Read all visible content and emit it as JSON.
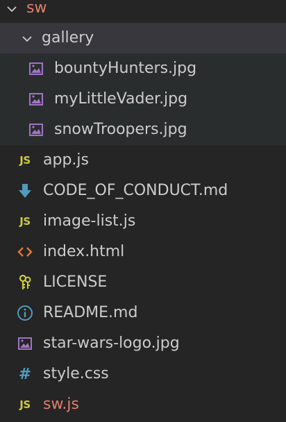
{
  "explorer": {
    "root": {
      "label": "sw",
      "expanded": true,
      "color": "#e37e6b"
    },
    "items": [
      {
        "label": "gallery",
        "type": "folder",
        "expanded": true,
        "icon": "chevron-down-icon"
      },
      {
        "label": "bountyHunters.jpg",
        "type": "image",
        "icon": "image-icon"
      },
      {
        "label": "myLittleVader.jpg",
        "type": "image",
        "icon": "image-icon"
      },
      {
        "label": "snowTroopers.jpg",
        "type": "image",
        "icon": "image-icon"
      },
      {
        "label": "app.js",
        "type": "js",
        "icon": "js-icon",
        "badge": "JS"
      },
      {
        "label": "CODE_OF_CONDUCT.md",
        "type": "md",
        "icon": "download-arrow-icon"
      },
      {
        "label": "image-list.js",
        "type": "js",
        "icon": "js-icon",
        "badge": "JS"
      },
      {
        "label": "index.html",
        "type": "html",
        "icon": "code-brackets-icon"
      },
      {
        "label": "LICENSE",
        "type": "license",
        "icon": "keys-icon"
      },
      {
        "label": "README.md",
        "type": "readme",
        "icon": "info-icon"
      },
      {
        "label": "star-wars-logo.jpg",
        "type": "image",
        "icon": "image-icon"
      },
      {
        "label": "style.css",
        "type": "css",
        "icon": "hash-icon",
        "badge": "#"
      },
      {
        "label": "sw.js",
        "type": "js",
        "icon": "js-icon",
        "badge": "JS",
        "modified": true
      }
    ],
    "colors": {
      "background": "#252526",
      "folder_highlight": "#37373d",
      "text": "#cccccc",
      "modified": "#e37e6b",
      "js": "#cbcb41",
      "css": "#519aba",
      "image": "#a074c4",
      "html": "#e37933",
      "md": "#519aba"
    }
  }
}
